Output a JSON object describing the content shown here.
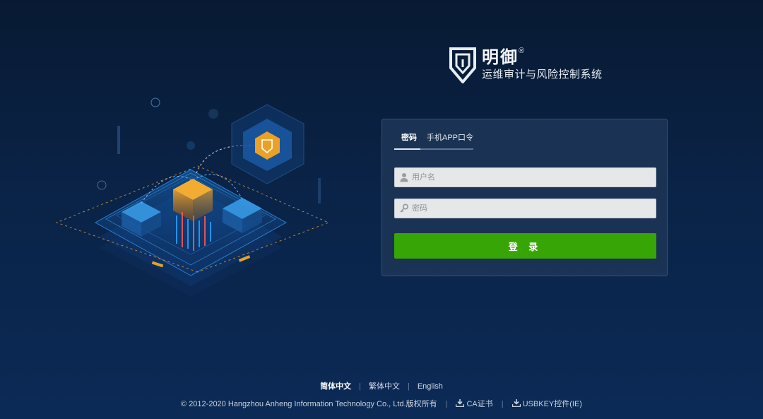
{
  "brand": {
    "name": "明御",
    "registered": "®",
    "subtitle": "运维审计与风险控制系统"
  },
  "login": {
    "tabs": [
      {
        "label": "密码",
        "active": true
      },
      {
        "label": "手机APP口令",
        "active": false
      }
    ],
    "username": {
      "placeholder": "用户名",
      "value": "",
      "icon": "user-icon"
    },
    "password": {
      "placeholder": "密码",
      "value": "",
      "icon": "key-icon"
    },
    "submit_label": "登 录"
  },
  "languages": [
    {
      "label": "简体中文",
      "active": true
    },
    {
      "label": "繁体中文",
      "active": false
    },
    {
      "label": "English",
      "active": false
    }
  ],
  "footer": {
    "copyright": "© 2012-2020 Hangzhou Anheng Information Technology Co., Ltd.版权所有",
    "ca_cert_label": "CA证书",
    "usbkey_label": "USBKEY控件(IE)",
    "download_icon": "download-icon"
  },
  "colors": {
    "background": "#0a2347",
    "accent_green": "#37a505",
    "illustration_orange": "#e89a1c",
    "illustration_blue": "#2b8fd8"
  }
}
